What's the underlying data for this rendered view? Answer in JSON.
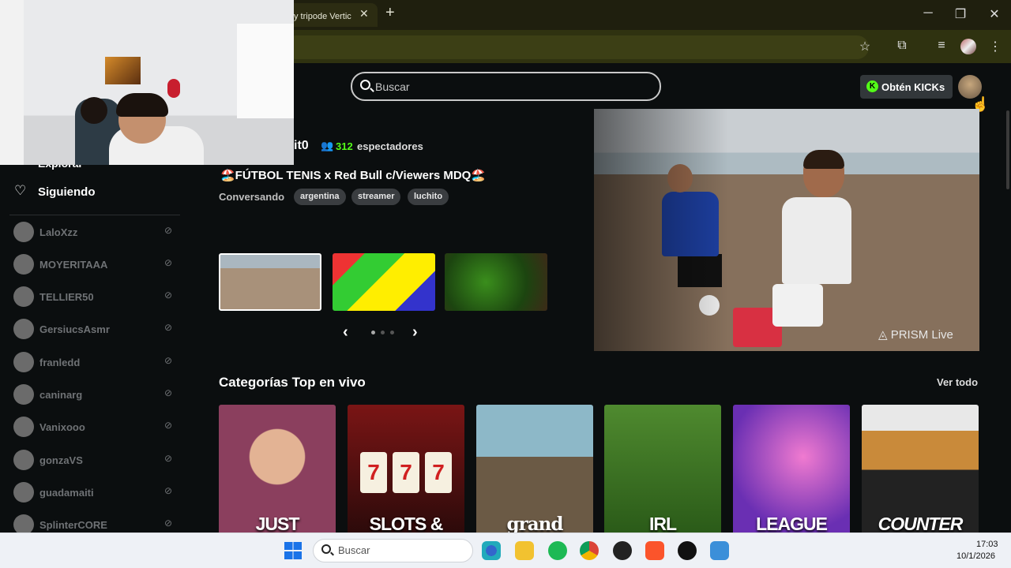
{
  "browser": {
    "tab_title": "y tripode Vertic",
    "tab_close": "✕",
    "new_tab": "+",
    "window_controls": {
      "minimize": "─",
      "restore": "❐",
      "close": "✕"
    },
    "toolbar_icons": [
      "star-icon",
      "extensions-icon",
      "media-icon",
      "profile-icon",
      "menu-icon"
    ]
  },
  "header": {
    "search_placeholder": "Buscar",
    "kicks_label": "Obtén KICKs",
    "kicks_icon": "K"
  },
  "sidebar": {
    "explorar": "Explorar",
    "siguiendo": "Siguiendo",
    "following": [
      {
        "name": "LaloXzz"
      },
      {
        "name": "MOYERITAAA"
      },
      {
        "name": "TELLIER50"
      },
      {
        "name": "GersiucsAsmr"
      },
      {
        "name": "franledd"
      },
      {
        "name": "caninarg"
      },
      {
        "name": "Vanixooo"
      },
      {
        "name": "gonzaVS"
      },
      {
        "name": "guadamaiti"
      },
      {
        "name": "SplinterCORE"
      }
    ]
  },
  "featured": {
    "streamer_name": "it0",
    "viewer_count": "312",
    "viewer_label": "espectadores",
    "title": "🏖️FÚTBOL TENIS x Red Bull c/Viewers MDQ🏖️",
    "category": "Conversando",
    "tags": [
      "argentina",
      "streamer",
      "luchito"
    ],
    "carousel_prev": "‹",
    "carousel_next": "›",
    "player_watermark": "◬ PRISM Live"
  },
  "categories": {
    "title": "Categorías Top en vivo",
    "see_all": "Ver todo",
    "items": [
      {
        "label": "JUST"
      },
      {
        "label": "SLOTS &"
      },
      {
        "label": "grand"
      },
      {
        "label": "IRL"
      },
      {
        "label": "LEAGUE"
      },
      {
        "label": "COUNTER"
      }
    ],
    "slot_symbols": [
      "7",
      "7",
      "7"
    ]
  },
  "taskbar": {
    "search_text": "Buscar",
    "time": "17:03",
    "date": "10/1/2026",
    "apps": [
      "edge",
      "files",
      "spotify",
      "chrome",
      "obs",
      "brave",
      "tiktok",
      "app"
    ]
  },
  "colors": {
    "kick_green": "#53fc18",
    "bg": "#0b0e0f"
  }
}
